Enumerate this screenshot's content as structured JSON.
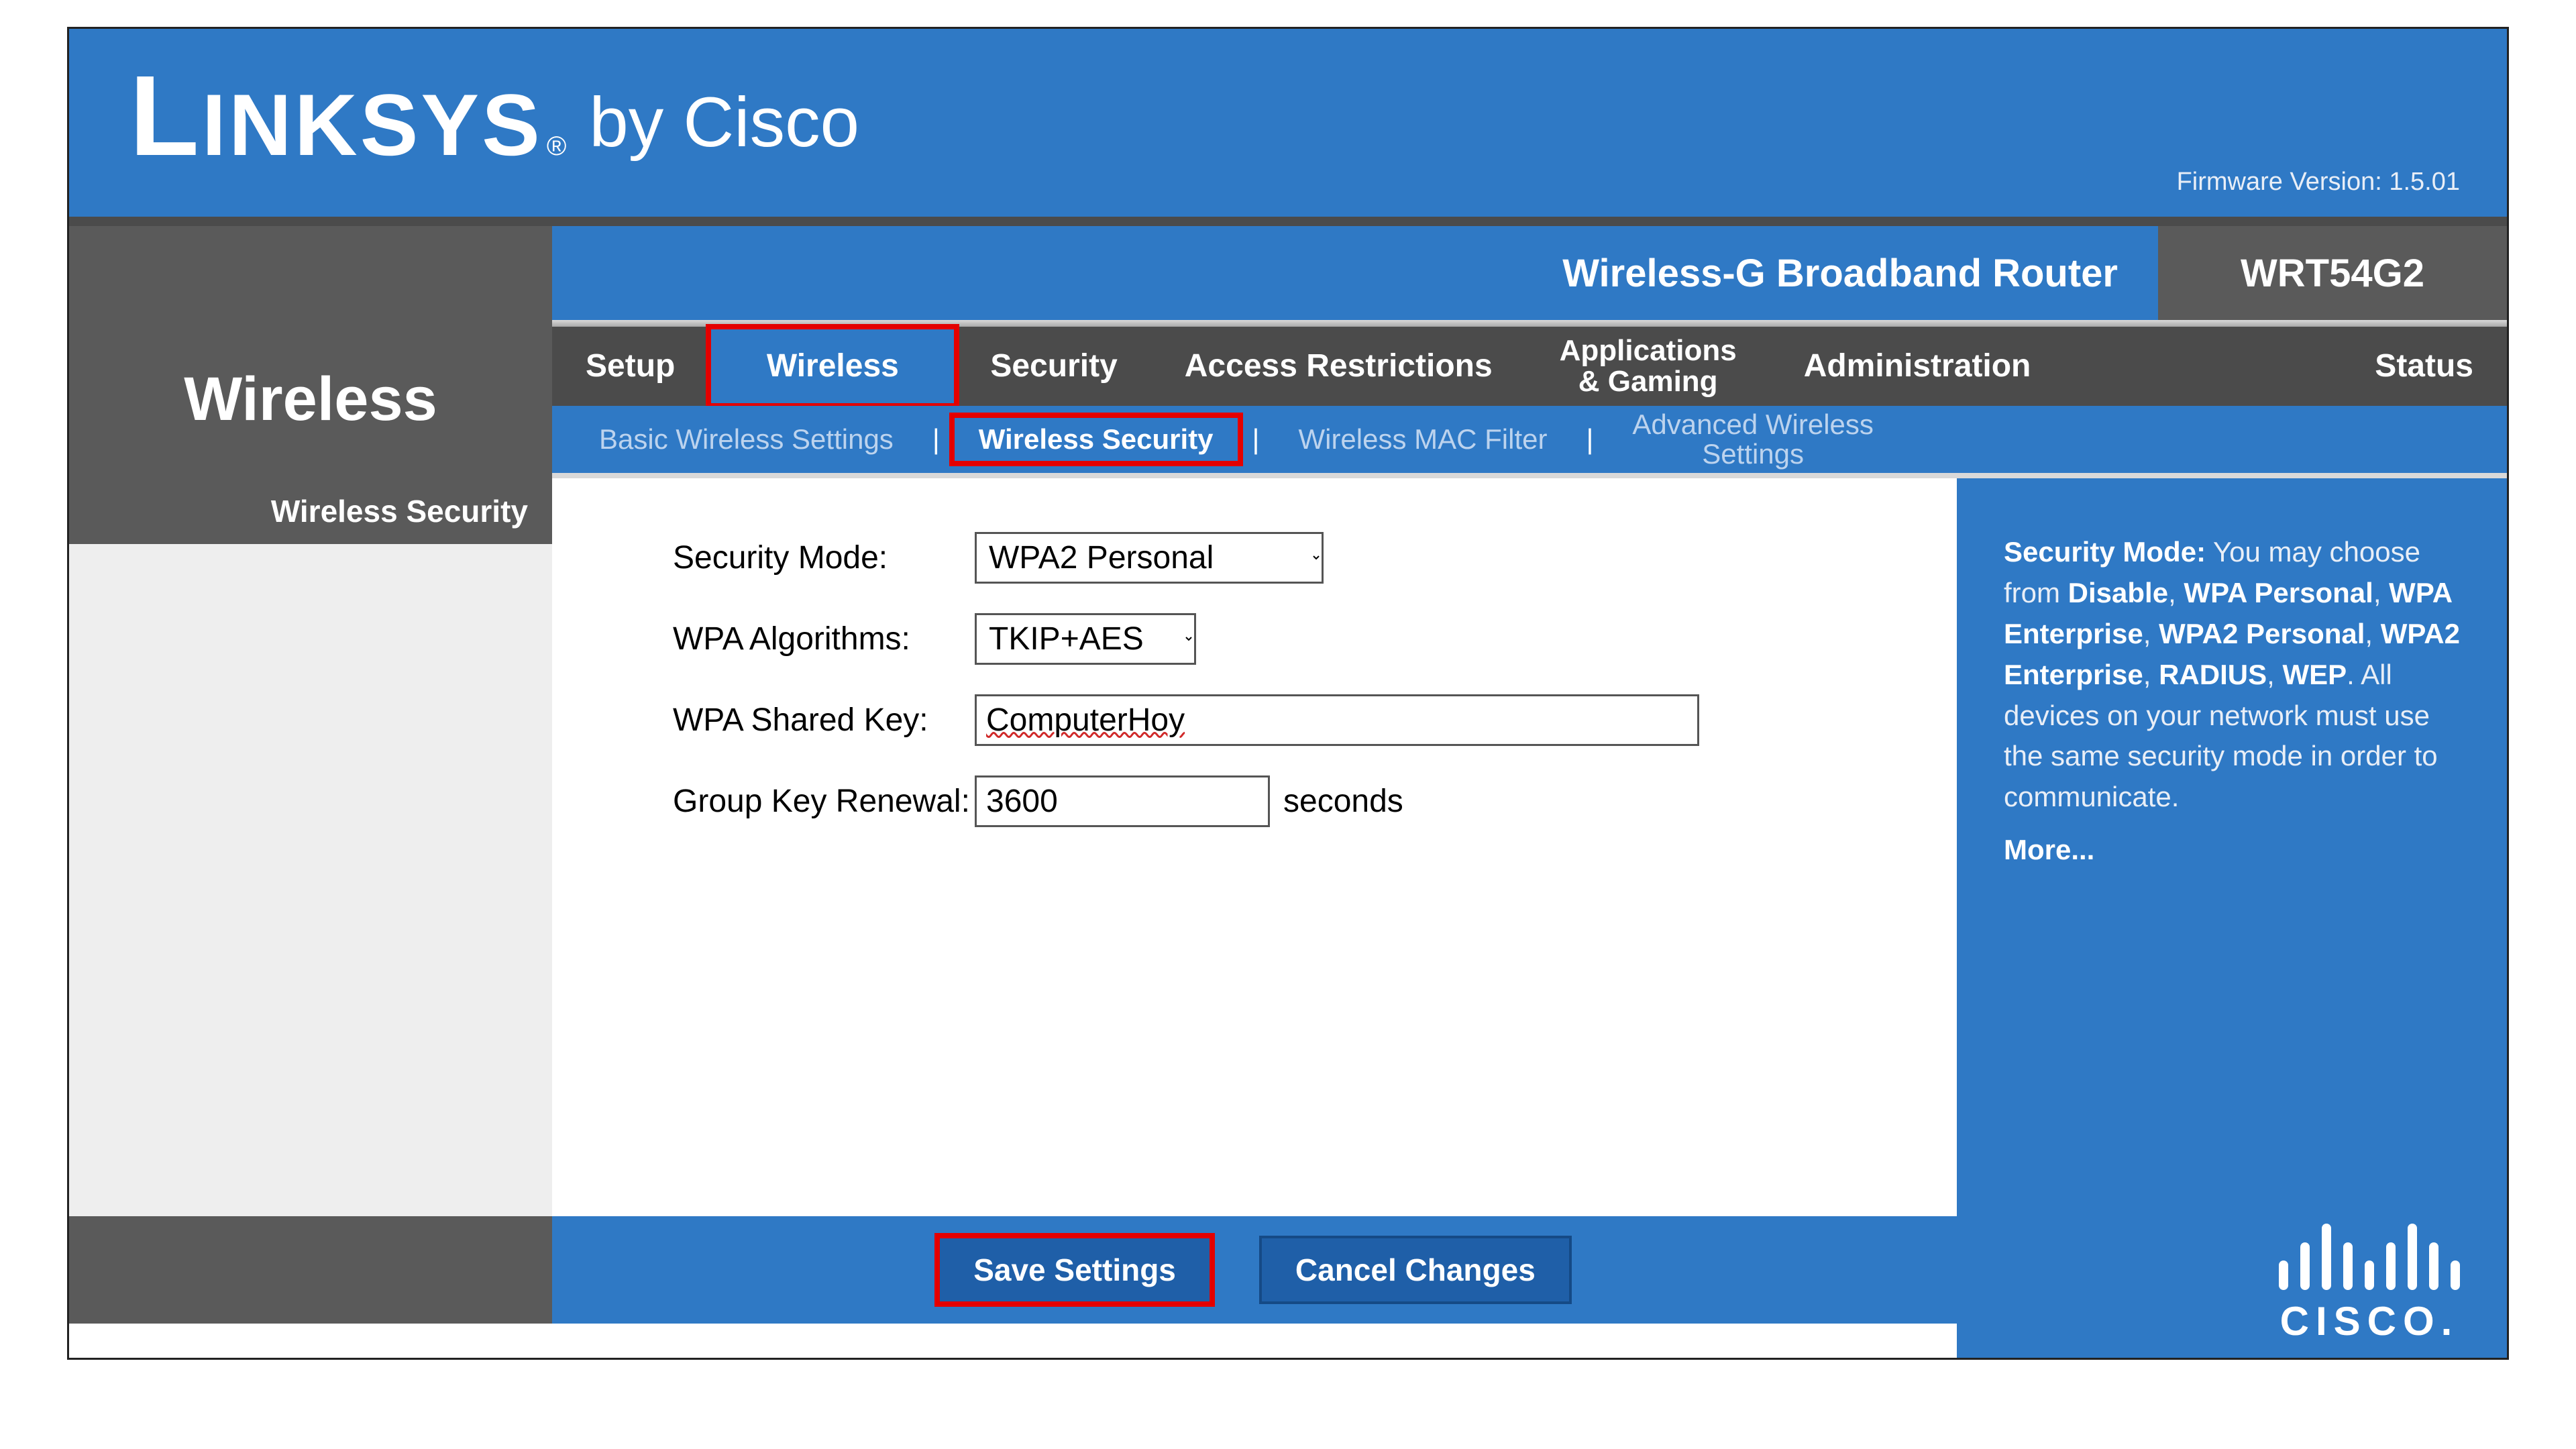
{
  "header": {
    "brand_main": "LINKSYS",
    "brand_sub": "by Cisco",
    "firmware_label": "Firmware Version: 1.5.01"
  },
  "title_row": {
    "router_name": "Wireless-G Broadband Router",
    "model": "WRT54G2"
  },
  "page_title": "Wireless",
  "main_tabs": {
    "setup": "Setup",
    "wireless": "Wireless",
    "security": "Security",
    "access": "Access Restrictions",
    "apps": "Applications\n& Gaming",
    "admin": "Administration",
    "status": "Status"
  },
  "sub_tabs": {
    "basic": "Basic Wireless Settings",
    "security": "Wireless Security",
    "mac": "Wireless MAC Filter",
    "advanced": "Advanced Wireless\nSettings"
  },
  "side_label": "Wireless Security",
  "form": {
    "security_mode_label": "Security Mode:",
    "security_mode_value": "WPA2 Personal",
    "algo_label": "WPA Algorithms:",
    "algo_value": "TKIP+AES",
    "key_label": "WPA Shared  Key:",
    "key_value": "ComputerHoy",
    "renewal_label": "Group Key  Renewal:",
    "renewal_value": "3600",
    "renewal_unit": "seconds"
  },
  "help": {
    "title": "Security Mode:",
    "pre": " You may choose from ",
    "opt_disable": "Disable",
    "opt_wpa_personal": "WPA Personal",
    "opt_wpa_enterprise": "WPA Enterprise",
    "opt_wpa2_personal": "WPA2 Personal",
    "opt_wpa2_enterprise": "WPA2 Enterprise",
    "opt_radius": "RADIUS",
    "opt_wep": "WEP",
    "post": ". All devices on your network must use the same security mode in order to communicate.",
    "more": "More..."
  },
  "footer": {
    "save": "Save Settings",
    "cancel": "Cancel Changes",
    "cisco": "CISCO"
  }
}
